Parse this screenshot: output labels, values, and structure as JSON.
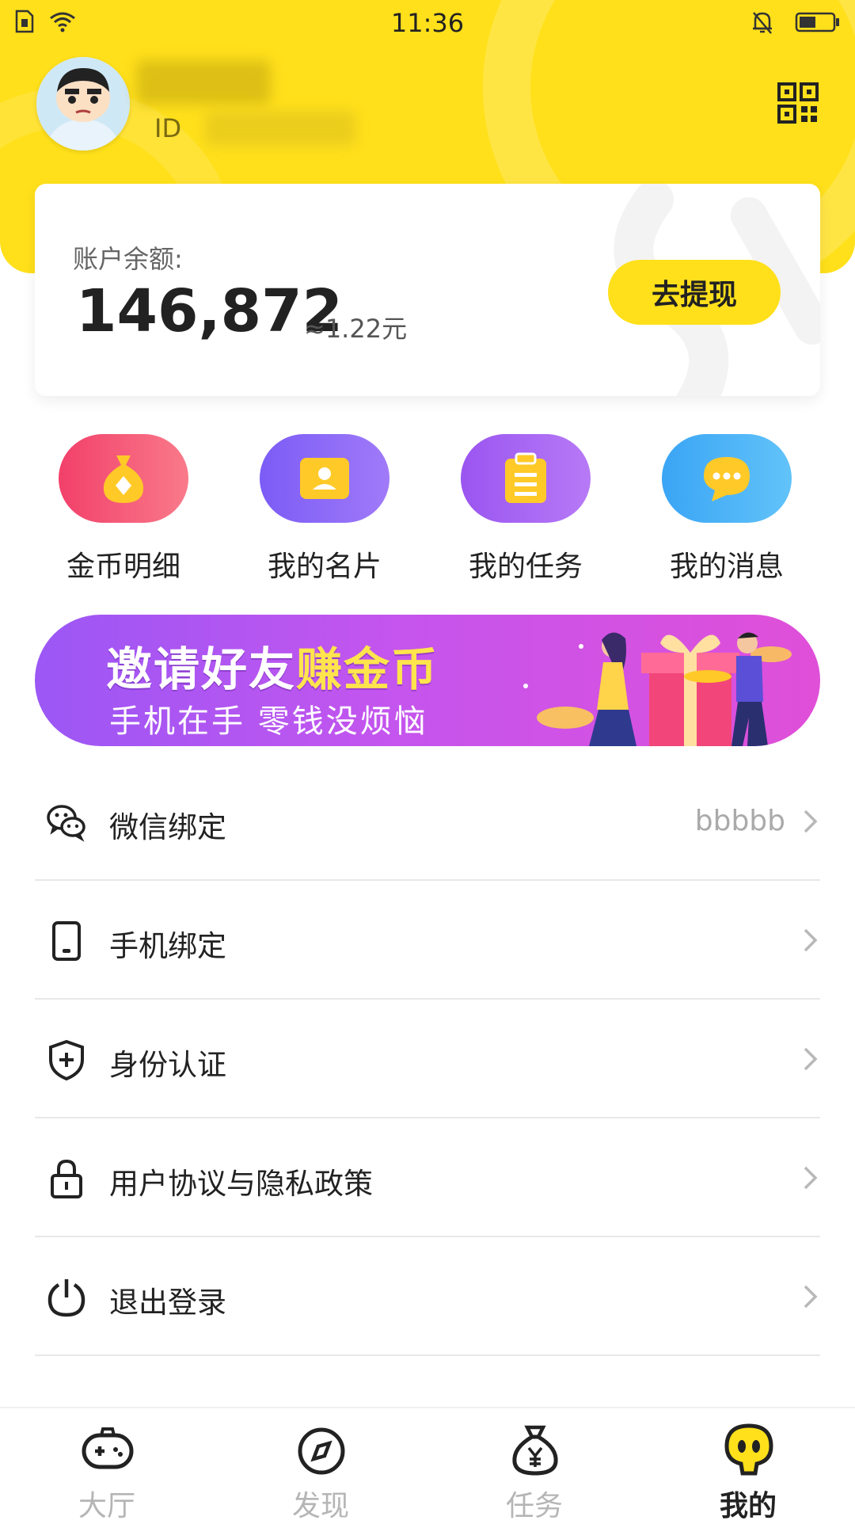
{
  "status_bar": {
    "time": "11:36"
  },
  "profile": {
    "id_label": "ID"
  },
  "balance": {
    "label": "账户余额:",
    "amount": "146,872",
    "approx": "≈1.22元",
    "withdraw_label": "去提现"
  },
  "shortcuts": [
    {
      "label": "金币明细",
      "icon": "money-bag-icon",
      "color": "#F4506A"
    },
    {
      "label": "我的名片",
      "icon": "contact-card-icon",
      "color": "#8A5CF5"
    },
    {
      "label": "我的任务",
      "icon": "clipboard-icon",
      "color": "#9C59F2"
    },
    {
      "label": "我的消息",
      "icon": "chat-bubble-icon",
      "color": "#3FA9F5"
    }
  ],
  "banner": {
    "title_part1": "邀请好友",
    "title_part2": "赚金币",
    "subtitle": "手机在手 零钱没烦恼"
  },
  "menu": [
    {
      "label": "微信绑定",
      "value": "bbbbb",
      "icon": "wechat-icon"
    },
    {
      "label": "手机绑定",
      "value": "",
      "icon": "phone-icon"
    },
    {
      "label": "身份认证",
      "value": "",
      "icon": "shield-icon"
    },
    {
      "label": "用户协议与隐私政策",
      "value": "",
      "icon": "lock-icon"
    },
    {
      "label": "退出登录",
      "value": "",
      "icon": "power-icon"
    }
  ],
  "tabs": [
    {
      "label": "大厅",
      "icon": "gamepad-icon"
    },
    {
      "label": "发现",
      "icon": "compass-icon"
    },
    {
      "label": "任务",
      "icon": "yen-bag-icon"
    },
    {
      "label": "我的",
      "icon": "mascot-icon",
      "active": true
    }
  ],
  "colors": {
    "brand_yellow": "#FFE01B"
  }
}
